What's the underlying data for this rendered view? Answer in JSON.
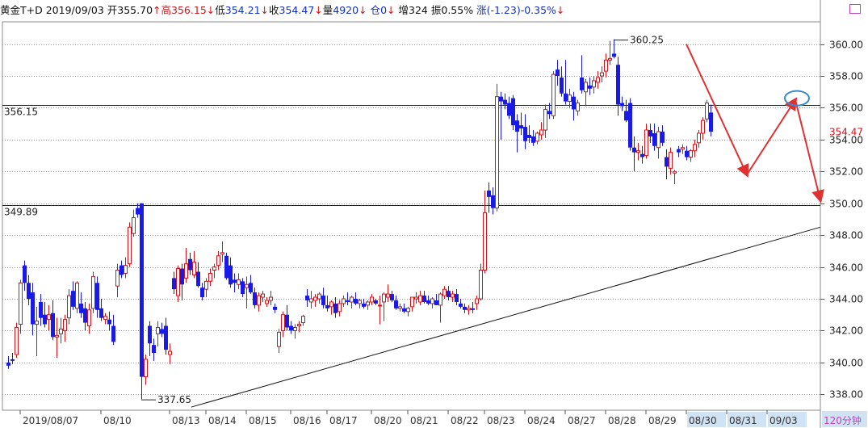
{
  "header": {
    "title": "黄金T+D",
    "date": "2019/09/03",
    "open_label": "开",
    "open": "355.70",
    "open_arrow": "↑",
    "high_label": "高",
    "high": "356.15",
    "high_arrow": "↓",
    "low_label": "低",
    "low": "354.21",
    "low_arrow": "↓",
    "close_label": "收",
    "close": "354.47",
    "close_arrow": "↓",
    "vol_label": "量",
    "volume": "4920",
    "vol_arrow": "↓",
    "oi_label": "仓",
    "open_interest": "0",
    "oi_arrow": "↓",
    "inc_label": "增",
    "increase": "324",
    "amp_label": "振",
    "amplitude": "0.55%",
    "chg_label": "涨",
    "change": "(-1.23)-0.35%",
    "chg_arrow": "↓"
  },
  "colors": {
    "up": "#d0151b",
    "down": "#1a1ae6",
    "grid": "#9a9a9a",
    "axis_text": "#222222",
    "annotation_red": "#e03030",
    "ellipse": "#3a8ad0",
    "last_price": "#d0151b",
    "period_bg": "#cfe3f5",
    "period_text": "#c040c0"
  },
  "chart_data": {
    "type": "candlestick",
    "period_label": "120分钟",
    "ylim": [
      337.0,
      361.4
    ],
    "yticks": [
      338,
      340,
      342,
      344,
      346,
      348,
      350,
      352,
      354,
      356,
      358,
      360
    ],
    "ytick_labels": [
      "338.00",
      "340.00",
      "342.00",
      "344.00",
      "346.00",
      "348.00",
      "350.00",
      "352.00",
      "354.00",
      "356.00",
      "358.00",
      "360.00"
    ],
    "last_price_label": "354.47",
    "last_price": 354.47,
    "x_labels": [
      "2019/08/07",
      "08/10",
      "08/13",
      "08/14",
      "08/15",
      "08/16",
      "08/17",
      "08/20",
      "08/21",
      "08/22",
      "08/23",
      "08/24",
      "08/27",
      "08/28",
      "08/29",
      "08/30",
      "08/31",
      "09/03"
    ],
    "x_label_bars": [
      3,
      23,
      40,
      49,
      59,
      70,
      79,
      90,
      99,
      109,
      118,
      128,
      138,
      148,
      158,
      168,
      178,
      188
    ],
    "highlight_labels": [
      "08/30",
      "08/31",
      "09/03"
    ],
    "candles": [
      [
        340.0,
        340.4,
        339.6,
        339.8
      ],
      [
        340.2,
        340.6,
        339.9,
        340.1
      ],
      [
        340.5,
        342.5,
        340.3,
        342.2
      ],
      [
        342.4,
        345.2,
        341.8,
        345.0
      ],
      [
        346.1,
        346.4,
        344.5,
        345.0
      ],
      [
        345.0,
        345.5,
        343.6,
        344.0
      ],
      [
        344.4,
        345.0,
        341.7,
        342.4
      ],
      [
        342.4,
        343.5,
        340.4,
        342.6
      ],
      [
        343.8,
        344.3,
        342.3,
        342.8
      ],
      [
        343.0,
        343.8,
        342.2,
        342.4
      ],
      [
        342.7,
        343.6,
        342.0,
        343.0
      ],
      [
        343.1,
        343.9,
        341.4,
        341.6
      ],
      [
        341.6,
        342.8,
        340.3,
        341.7
      ],
      [
        341.8,
        342.8,
        341.2,
        342.1
      ],
      [
        342.0,
        343.0,
        341.3,
        342.7
      ],
      [
        342.8,
        344.6,
        342.4,
        344.2
      ],
      [
        344.5,
        345.1,
        343.3,
        343.5
      ],
      [
        343.4,
        345.1,
        343.1,
        345.0
      ],
      [
        343.7,
        344.4,
        342.8,
        343.1
      ],
      [
        343.4,
        343.8,
        342.0,
        342.5
      ],
      [
        342.3,
        343.7,
        341.8,
        343.3
      ],
      [
        343.4,
        345.7,
        343.1,
        345.4
      ],
      [
        345.0,
        345.4,
        342.8,
        343.3
      ],
      [
        343.4,
        344.0,
        342.6,
        342.8
      ],
      [
        342.7,
        343.1,
        342.4,
        342.9
      ],
      [
        342.7,
        343.2,
        342.0,
        342.4
      ],
      [
        342.3,
        343.0,
        341.1,
        341.3
      ],
      [
        344.8,
        346.2,
        344.1,
        345.8
      ],
      [
        346.1,
        346.4,
        345.3,
        345.5
      ],
      [
        345.6,
        346.6,
        345.3,
        346.1
      ],
      [
        346.2,
        348.8,
        346.0,
        348.5
      ],
      [
        348.1,
        349.6,
        347.9,
        349.1
      ],
      [
        349.7,
        350.0,
        349.1,
        349.3
      ],
      [
        350.0,
        350.0,
        337.7,
        339.1
      ],
      [
        339.1,
        340.5,
        338.6,
        340.2
      ],
      [
        342.3,
        342.6,
        340.4,
        341.2
      ],
      [
        341.1,
        341.5,
        340.1,
        340.6
      ],
      [
        341.8,
        342.6,
        341.0,
        342.2
      ],
      [
        342.1,
        342.5,
        341.6,
        341.8
      ],
      [
        342.3,
        342.8,
        340.5,
        340.8
      ],
      [
        340.5,
        341.2,
        339.9,
        340.7
      ],
      [
        345.3,
        345.7,
        344.3,
        344.6
      ],
      [
        344.2,
        346.1,
        343.8,
        345.9
      ],
      [
        345.9,
        346.2,
        343.9,
        344.9
      ],
      [
        345.3,
        347.2,
        345.0,
        346.2
      ],
      [
        346.5,
        346.9,
        345.5,
        345.8
      ],
      [
        345.5,
        347.0,
        345.3,
        346.3
      ],
      [
        345.7,
        346.3,
        344.7,
        344.8
      ],
      [
        344.7,
        345.0,
        343.9,
        344.1
      ],
      [
        344.6,
        345.3,
        344.1,
        345.1
      ],
      [
        345.1,
        345.9,
        344.8,
        345.6
      ],
      [
        345.8,
        346.2,
        345.3,
        346.0
      ],
      [
        346.1,
        347.0,
        345.8,
        346.7
      ],
      [
        346.8,
        347.6,
        346.3,
        346.9
      ],
      [
        346.7,
        346.9,
        345.2,
        345.3
      ],
      [
        346.1,
        346.6,
        344.7,
        344.9
      ],
      [
        345.2,
        345.6,
        344.4,
        345.0
      ],
      [
        344.9,
        345.6,
        344.6,
        345.2
      ],
      [
        345.1,
        345.3,
        344.1,
        344.3
      ],
      [
        344.7,
        345.4,
        343.4,
        344.9
      ],
      [
        345.0,
        345.5,
        344.3,
        344.4
      ],
      [
        344.4,
        344.7,
        343.4,
        343.6
      ],
      [
        343.6,
        344.4,
        343.2,
        344.2
      ],
      [
        344.1,
        344.5,
        343.8,
        344.3
      ],
      [
        343.7,
        344.1,
        343.5,
        343.9
      ],
      [
        343.9,
        344.5,
        343.6,
        344.1
      ],
      [
        343.5,
        343.7,
        343.1,
        343.3
      ],
      [
        341.0,
        342.1,
        340.6,
        341.9
      ],
      [
        342.0,
        343.2,
        341.6,
        343.0
      ],
      [
        343.0,
        343.6,
        342.0,
        342.2
      ],
      [
        342.3,
        342.6,
        341.8,
        342.0
      ],
      [
        342.0,
        342.4,
        341.5,
        342.2
      ],
      [
        342.3,
        342.6,
        341.9,
        342.4
      ],
      [
        342.5,
        343.0,
        342.3,
        342.9
      ],
      [
        344.2,
        344.6,
        343.5,
        343.9
      ],
      [
        343.8,
        344.5,
        343.4,
        344.0
      ],
      [
        343.9,
        344.3,
        343.5,
        344.1
      ],
      [
        344.0,
        344.4,
        343.7,
        344.3
      ],
      [
        344.2,
        344.7,
        343.4,
        343.6
      ],
      [
        343.6,
        344.2,
        343.2,
        343.4
      ],
      [
        343.5,
        343.9,
        343.0,
        343.8
      ],
      [
        343.7,
        344.1,
        342.8,
        343.1
      ],
      [
        343.2,
        343.9,
        342.9,
        343.7
      ],
      [
        343.7,
        344.2,
        343.5,
        344.0
      ],
      [
        343.9,
        344.4,
        343.6,
        343.8
      ],
      [
        343.8,
        344.2,
        343.4,
        344.1
      ],
      [
        344.0,
        344.4,
        343.6,
        343.7
      ],
      [
        343.7,
        344.0,
        343.4,
        343.9
      ],
      [
        343.7,
        344.0,
        343.4,
        343.5
      ],
      [
        343.6,
        343.9,
        343.3,
        343.8
      ],
      [
        343.8,
        344.3,
        343.6,
        344.1
      ],
      [
        343.9,
        344.0,
        343.6,
        343.7
      ],
      [
        343.6,
        344.2,
        342.4,
        343.6
      ],
      [
        343.8,
        344.4,
        342.6,
        344.3
      ],
      [
        344.1,
        344.9,
        343.8,
        344.3
      ],
      [
        344.3,
        344.5,
        343.8,
        343.9
      ],
      [
        343.9,
        344.2,
        343.3,
        343.4
      ],
      [
        343.4,
        343.7,
        343.2,
        343.5
      ],
      [
        343.4,
        343.7,
        343.1,
        343.2
      ],
      [
        343.2,
        343.5,
        342.9,
        343.4
      ],
      [
        343.5,
        344.0,
        343.2,
        344.1
      ],
      [
        344.0,
        344.4,
        343.7,
        344.1
      ],
      [
        343.8,
        344.5,
        343.6,
        344.2
      ],
      [
        344.2,
        344.5,
        343.7,
        343.8
      ],
      [
        343.9,
        344.2,
        343.6,
        343.7
      ],
      [
        343.7,
        344.1,
        343.4,
        344.0
      ],
      [
        343.9,
        344.3,
        343.6,
        343.6
      ],
      [
        343.6,
        344.4,
        342.5,
        344.3
      ],
      [
        344.2,
        344.8,
        344.0,
        344.6
      ],
      [
        344.5,
        344.8,
        343.9,
        344.1
      ],
      [
        344.1,
        344.5,
        343.8,
        344.3
      ],
      [
        344.3,
        344.6,
        343.6,
        343.8
      ],
      [
        343.7,
        344.0,
        343.4,
        343.5
      ],
      [
        343.5,
        343.7,
        343.1,
        343.3
      ],
      [
        343.3,
        343.6,
        343.0,
        343.4
      ],
      [
        343.4,
        343.8,
        343.1,
        343.3
      ],
      [
        343.7,
        344.2,
        343.3,
        344.0
      ],
      [
        344.0,
        346.2,
        343.9,
        345.8
      ],
      [
        345.8,
        350.8,
        345.6,
        349.4
      ],
      [
        350.8,
        351.3,
        349.4,
        350.4
      ],
      [
        350.5,
        351.0,
        349.3,
        349.7
      ],
      [
        349.7,
        357.5,
        349.5,
        356.7
      ],
      [
        356.7,
        357.0,
        354.0,
        356.4
      ],
      [
        356.5,
        356.9,
        355.9,
        356.2
      ],
      [
        356.3,
        356.7,
        355.3,
        355.5
      ],
      [
        356.6,
        356.8,
        354.6,
        354.9
      ],
      [
        355.2,
        355.6,
        353.2,
        354.5
      ],
      [
        354.9,
        355.7,
        354.3,
        354.7
      ],
      [
        354.8,
        355.6,
        353.4,
        353.9
      ],
      [
        354.3,
        354.9,
        353.8,
        354.1
      ],
      [
        354.2,
        354.6,
        353.6,
        353.8
      ],
      [
        353.9,
        354.5,
        353.7,
        354.4
      ],
      [
        354.3,
        355.1,
        354.0,
        354.6
      ],
      [
        354.6,
        356.2,
        354.1,
        355.9
      ],
      [
        355.8,
        356.3,
        355.3,
        355.6
      ],
      [
        355.5,
        358.3,
        355.3,
        358.1
      ],
      [
        358.4,
        359.0,
        357.4,
        358.0
      ],
      [
        357.9,
        358.6,
        356.7,
        356.9
      ],
      [
        356.9,
        359.0,
        356.2,
        356.4
      ],
      [
        356.4,
        357.2,
        356.0,
        356.8
      ],
      [
        356.7,
        357.0,
        355.2,
        355.9
      ],
      [
        355.8,
        356.5,
        355.5,
        356.3
      ],
      [
        357.9,
        359.3,
        356.9,
        357.1
      ],
      [
        357.0,
        357.8,
        356.1,
        357.6
      ],
      [
        357.4,
        357.9,
        356.8,
        357.2
      ],
      [
        357.3,
        358.0,
        356.9,
        357.7
      ],
      [
        357.6,
        358.3,
        357.2,
        357.9
      ],
      [
        358.0,
        358.6,
        357.6,
        358.2
      ],
      [
        358.3,
        359.4,
        357.9,
        359.0
      ],
      [
        359.0,
        360.2,
        358.7,
        359.1
      ],
      [
        359.4,
        360.3,
        359.1,
        359.2
      ],
      [
        358.7,
        359.2,
        355.5,
        356.2
      ],
      [
        356.3,
        356.7,
        355.8,
        356.1
      ],
      [
        355.8,
        356.5,
        355.1,
        355.2
      ],
      [
        356.3,
        356.6,
        353.3,
        353.5
      ],
      [
        353.5,
        354.2,
        352.0,
        353.2
      ],
      [
        353.2,
        353.8,
        352.7,
        353.3
      ],
      [
        353.1,
        353.6,
        352.5,
        352.9
      ],
      [
        353.0,
        355.0,
        352.8,
        354.6
      ],
      [
        354.6,
        355.0,
        353.8,
        354.2
      ],
      [
        354.4,
        355.0,
        353.3,
        353.6
      ],
      [
        353.5,
        354.8,
        352.8,
        354.5
      ],
      [
        354.5,
        354.9,
        353.6,
        353.8
      ],
      [
        352.9,
        353.4,
        351.5,
        352.3
      ],
      [
        352.2,
        353.5,
        351.8,
        353.2
      ],
      [
        351.9,
        352.1,
        351.2,
        352.0
      ],
      [
        353.4,
        353.6,
        352.9,
        353.2
      ],
      [
        353.4,
        353.7,
        353.1,
        353.5
      ],
      [
        353.3,
        353.6,
        352.7,
        352.9
      ],
      [
        352.9,
        353.4,
        352.6,
        353.3
      ],
      [
        353.3,
        354.0,
        352.9,
        353.7
      ],
      [
        353.8,
        354.6,
        353.5,
        354.4
      ],
      [
        354.4,
        355.4,
        354.0,
        355.2
      ],
      [
        355.3,
        356.5,
        355.1,
        356.3
      ],
      [
        355.7,
        356.2,
        354.2,
        354.5
      ]
    ],
    "candle_x": [
      10,
      15,
      20,
      25,
      30,
      35,
      40,
      45,
      50,
      55,
      60,
      65,
      70,
      75,
      80,
      85,
      90,
      95,
      100,
      105,
      110,
      115,
      120,
      125,
      130,
      135,
      140,
      145,
      150,
      155,
      160,
      165,
      170,
      175,
      180,
      185,
      190,
      195,
      200,
      205,
      210,
      215,
      220,
      225,
      230,
      235,
      240,
      245,
      250,
      255,
      260,
      265,
      270,
      275,
      280,
      285,
      290,
      295,
      300,
      305,
      310,
      315,
      320,
      325,
      330,
      335,
      340,
      345,
      350,
      355,
      360,
      365,
      370,
      375,
      380,
      385,
      390,
      395,
      400,
      405,
      410,
      415,
      420,
      425,
      430,
      435,
      440,
      445,
      450,
      455,
      460,
      465,
      470,
      475,
      480,
      485,
      490,
      495,
      500,
      505,
      510,
      515,
      520,
      525,
      530,
      535,
      540,
      545,
      550,
      555,
      560,
      565,
      570,
      575,
      580,
      585,
      590,
      595,
      600,
      605,
      610,
      615,
      620,
      625,
      630,
      635,
      640,
      645,
      650,
      655,
      660,
      665,
      670,
      675,
      680,
      685,
      690,
      695,
      700,
      705,
      710,
      715,
      720,
      725,
      730,
      735,
      740,
      745,
      750,
      755,
      760,
      765,
      770,
      775,
      780,
      785,
      790,
      795,
      800,
      805,
      810,
      815,
      820,
      825,
      830,
      835,
      840,
      845,
      850,
      855,
      860,
      865,
      870,
      875,
      880,
      885,
      890,
      895,
      900,
      905,
      910,
      915,
      920,
      925,
      930,
      935,
      940,
      945,
      950,
      955,
      960,
      965,
      970,
      975,
      980,
      985
    ],
    "h_lines": [
      {
        "price": 356.15,
        "label": "356.15"
      },
      {
        "price": 349.89,
        "label": "349.89"
      }
    ],
    "annotations": [
      {
        "type": "price-label",
        "price": 360.25,
        "label": "360.25",
        "bar": 150
      },
      {
        "type": "price-label",
        "price": 337.65,
        "label": "337.65",
        "bar": 33
      }
    ],
    "trendline": {
      "from": [
        237,
        337.2
      ],
      "to": [
        1016,
        348.5
      ]
    },
    "drawn_arrows": [
      [
        [
          850,
          360.0
        ],
        [
          925,
          351.8
        ]
      ],
      [
        [
          925,
          351.8
        ],
        [
          985,
          356.5
        ]
      ],
      [
        [
          985,
          356.5
        ],
        [
          1016,
          350.2
        ]
      ]
    ],
    "ellipse_marker": {
      "price": 356.6,
      "x": 987
    }
  }
}
